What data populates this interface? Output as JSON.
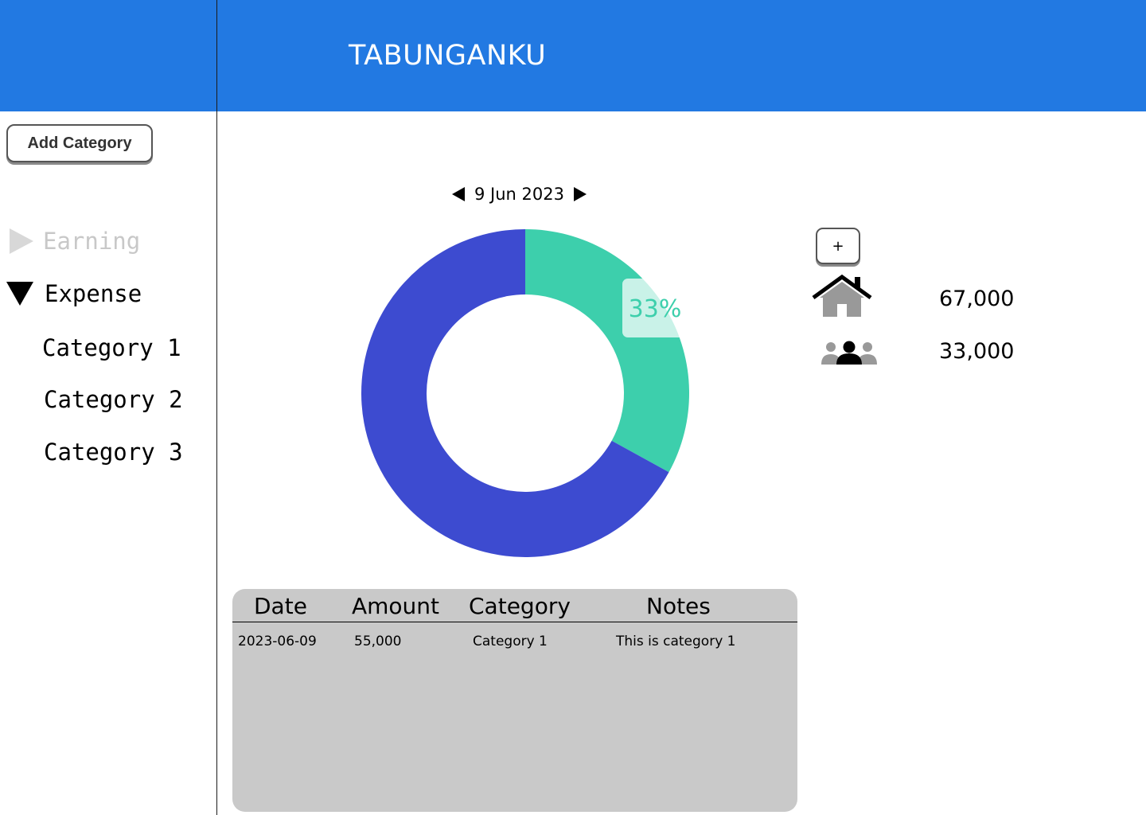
{
  "header": {
    "title": "TABUNGANKU"
  },
  "sidebar": {
    "add_category_label": "Add Category",
    "sections": [
      {
        "label": "Earning",
        "expanded": false
      },
      {
        "label": "Expense",
        "expanded": true
      }
    ],
    "expense_items": [
      "Category 1",
      "Category 2",
      "Category 3"
    ]
  },
  "date_nav": {
    "date": "9 Jun 2023"
  },
  "chart_data": {
    "type": "pie",
    "donut": true,
    "values": [
      33,
      67
    ],
    "labels": [
      "33%"
    ],
    "colors": [
      "#3dcfac",
      "#3d4bd0"
    ]
  },
  "summary": {
    "add_label": "+",
    "items": [
      {
        "icon": "house-icon",
        "value": "67,000"
      },
      {
        "icon": "people-icon",
        "value": "33,000"
      }
    ]
  },
  "table": {
    "columns": [
      "Date",
      "Amount",
      "Category",
      "Notes"
    ],
    "rows": [
      {
        "date": "2023-06-09",
        "amount": "55,000",
        "category": "Category 1",
        "notes": "This is category 1"
      }
    ]
  }
}
